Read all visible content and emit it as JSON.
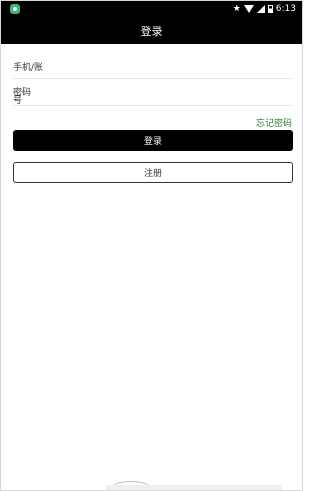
{
  "status_bar": {
    "time": "6:13",
    "icons": [
      "app-notification-icon",
      "star-icon",
      "wifi-icon",
      "signal-icon",
      "battery-icon"
    ]
  },
  "header": {
    "title": "登录"
  },
  "form": {
    "account_placeholder": "手机/账",
    "password_label": "密码号",
    "forgot_label": "忘记密码",
    "login_label": "登录",
    "register_label": "注册"
  },
  "colors": {
    "bar_background": "#000000",
    "forgot_link": "#2e7d32"
  }
}
